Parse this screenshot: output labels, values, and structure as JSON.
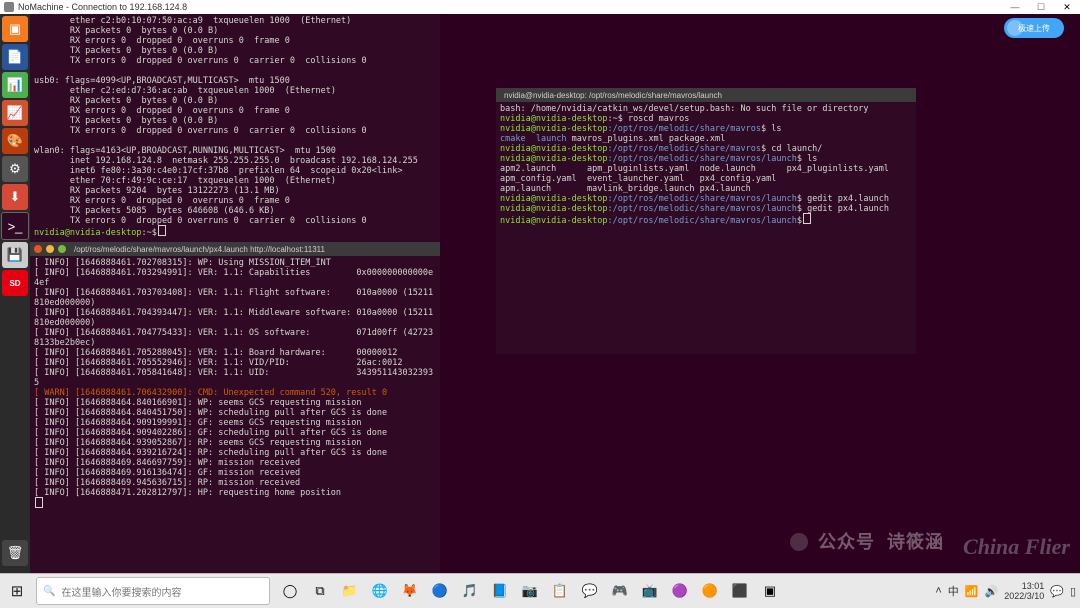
{
  "nm": {
    "title": "NoMachine - Connection to 192.168.124.8",
    "min": "—",
    "max": "☐",
    "close": "✕"
  },
  "upload": {
    "label": "极速上传"
  },
  "launcher": {
    "files": {
      "glyph": "▣"
    },
    "doc": {
      "glyph": "📄"
    },
    "calc": {
      "glyph": "📊"
    },
    "impress": {
      "glyph": "📈"
    },
    "draw": {
      "glyph": "🎨"
    },
    "settings": {
      "glyph": "⚙"
    },
    "software": {
      "glyph": "⬇"
    },
    "term": {
      "glyph": ">_"
    },
    "disk": {
      "glyph": "💾"
    },
    "sd": {
      "glyph": "SD"
    },
    "trash": {
      "glyph": "🗑"
    }
  },
  "term_top": {
    "lines": [
      "       ether c2:b0:10:07:50:ac:a9  txqueuelen 1000  (Ethernet)",
      "       RX packets 0  bytes 0 (0.0 B)",
      "       RX errors 0  dropped 0  overruns 0  frame 0",
      "       TX packets 0  bytes 0 (0.0 B)",
      "       TX errors 0  dropped 0 overruns 0  carrier 0  collisions 0",
      "",
      "usb0: flags=4099<UP,BROADCAST,MULTICAST>  mtu 1500",
      "       ether c2:ed:d7:36:ac:ab  txqueuelen 1000  (Ethernet)",
      "       RX packets 0  bytes 0 (0.0 B)",
      "       RX errors 0  dropped 0  overruns 0  frame 0",
      "       TX packets 0  bytes 0 (0.0 B)",
      "       TX errors 0  dropped 0 overruns 0  carrier 0  collisions 0",
      "",
      "wlan0: flags=4163<UP,BROADCAST,RUNNING,MULTICAST>  mtu 1500",
      "       inet 192.168.124.8  netmask 255.255.255.0  broadcast 192.168.124.255",
      "       inet6 fe80::3a30:c4e0:17cf:37b8  prefixlen 64  scopeid 0x20<link>",
      "       ether 70:cf:49:9c:ce:17  txqueuelen 1000  (Ethernet)",
      "       RX packets 9204  bytes 13122273 (13.1 MB)",
      "       RX errors 0  dropped 0  overruns 0  frame 0",
      "       TX packets 5085  bytes 646608 (646.6 KB)",
      "       TX errors 0  dropped 0 overruns 0  carrier 0  collisions 0",
      ""
    ],
    "prompt_user": "nvidia@nvidia-desktop",
    "prompt_symbol": ":~$"
  },
  "term_mid": {
    "title": "/opt/ros/melodic/share/mavros/launch/px4.launch http://localhost:11311",
    "lines": [
      "[ INFO] [1646888461.702708315]: WP: Using MISSION_ITEM_INT",
      "[ INFO] [1646888461.703294991]: VER: 1.1: Capabilities         0x000000000000e4ef",
      "[ INFO] [1646888461.703703408]: VER: 1.1: Flight software:     010a0000 (15211810ed000000)",
      "[ INFO] [1646888461.704393447]: VER: 1.1: Middleware software: 010a0000 (15211810ed000000)",
      "[ INFO] [1646888461.704775433]: VER: 1.1: OS software:         071d00ff (427238133be2b0ec)",
      "[ INFO] [1646888461.705288045]: VER: 1.1: Board hardware:      00000012",
      "[ INFO] [1646888461.705552946]: VER: 1.1: VID/PID:             26ac:0012",
      "[ INFO] [1646888461.705841648]: VER: 1.1: UID:                 3439511430323935"
    ],
    "warn": "[ WARN] [1646888461.706432900]: CMD: Unexpected command 520, result 0",
    "lines2": [
      "[ INFO] [1646888464.840166901]: WP: seems GCS requesting mission",
      "[ INFO] [1646888464.840451750]: WP: scheduling pull after GCS is done",
      "[ INFO] [1646888464.909199991]: GF: seems GCS requesting mission",
      "[ INFO] [1646888464.909402286]: GF: scheduling pull after GCS is done",
      "[ INFO] [1646888464.939052867]: RP: seems GCS requesting mission",
      "[ INFO] [1646888464.939216724]: RP: scheduling pull after GCS is done",
      "[ INFO] [1646888469.846697759]: WP: mission received",
      "[ INFO] [1646888469.916136474]: GF: mission received",
      "[ INFO] [1646888469.945636715]: RP: mission received",
      "[ INFO] [1646888471.202812797]: HP: requesting home position"
    ]
  },
  "term_right": {
    "title": "nvidia@nvidia-desktop: /opt/ros/melodic/share/mavros/launch",
    "line_bash": "bash: /home/nvidia/catkin_ws/devel/setup.bash: No such file or directory",
    "p1": {
      "user": "nvidia@nvidia-desktop",
      "path": ":~$",
      "cmd": " roscd mavros"
    },
    "p2": {
      "user": "nvidia@nvidia-desktop",
      "cwd": ":/opt/ros/melodic/share/mavros",
      "sym": "$",
      "cmd": " ls"
    },
    "cmake": "cmake",
    "launch": "launch",
    "rest1": "  mavros_plugins.xml  package.xml",
    "p3": {
      "user": "nvidia@nvidia-desktop",
      "cwd": ":/opt/ros/melodic/share/mavros",
      "sym": "$",
      "cmd": " cd launch/"
    },
    "p4": {
      "user": "nvidia@nvidia-desktop",
      "cwd": ":/opt/ros/melodic/share/mavros/launch",
      "sym": "$",
      "cmd": " ls"
    },
    "ls_lines": [
      "apm2.launch      apm_pluginlists.yaml  node.launch      px4_pluginlists.yaml",
      "apm_config.yaml  event_launcher.yaml   px4_config.yaml",
      "apm.launch       mavlink_bridge.launch px4.launch"
    ],
    "p5": {
      "user": "nvidia@nvidia-desktop",
      "cwd": ":/opt/ros/melodic/share/mavros/launch",
      "sym": "$",
      "cmd": " gedit px4.launch"
    },
    "p6": {
      "user": "nvidia@nvidia-desktop",
      "cwd": ":/opt/ros/melodic/share/mavros/launch",
      "sym": "$",
      "cmd": " gedit px4.launch"
    },
    "p7": {
      "user": "nvidia@nvidia-desktop",
      "cwd": ":/opt/ros/melodic/share/mavros/launch",
      "sym": "$",
      "cmd": ""
    }
  },
  "watermark": {
    "wx": "公众号",
    "wx2": "诗筱涵",
    "cf": "China Flier"
  },
  "taskbar": {
    "search_placeholder": "在这里输入你要搜索的内容",
    "icons": {
      "start": "⊞",
      "cortana": "◯",
      "task": "⧉",
      "ea": "📁",
      "c1": "🌐",
      "c2": "🦊",
      "c3": "🔵",
      "c4": "🎵",
      "c5": "📘",
      "c6": "📷",
      "c7": "📋",
      "c8": "💬",
      "c9": "🎮",
      "c10": "📺",
      "c11": "🟣",
      "c12": "🟠",
      "c13": "⬛",
      "c14": "▣"
    },
    "sys": {
      "up": "˄",
      "ime": "中",
      "wifi": "📶",
      "vol": "🔊"
    },
    "clock": {
      "time": "13:01",
      "date": "2022/3/10"
    },
    "bubble": "💬",
    "desk": "▯"
  }
}
